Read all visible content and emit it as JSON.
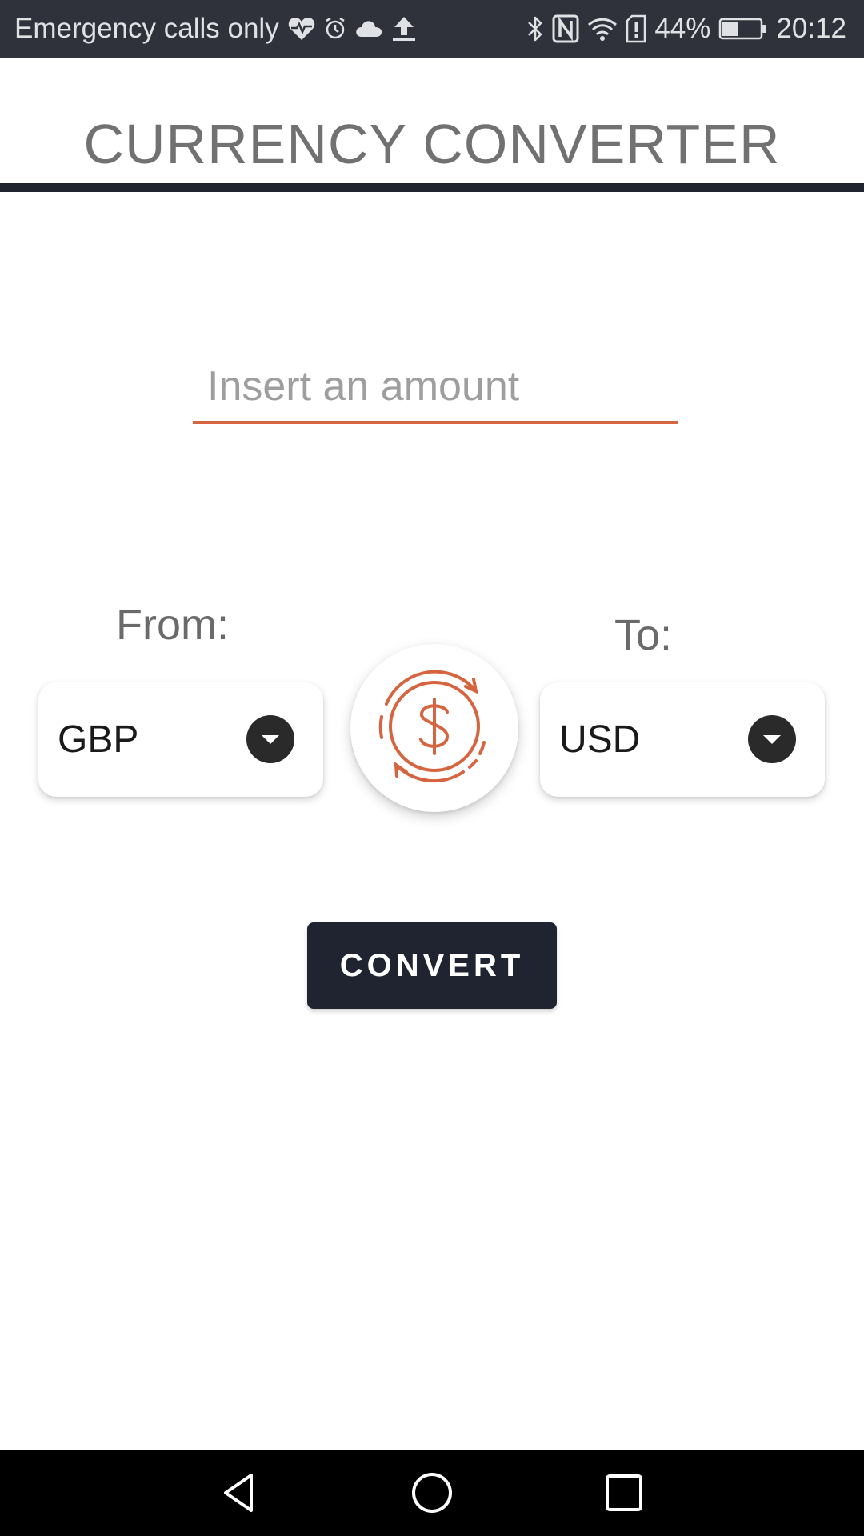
{
  "status_bar": {
    "carrier_text": "Emergency calls only",
    "battery_percent": "44%",
    "battery_level": 0.44,
    "time": "20:12",
    "left_icons": [
      "heart-pulse-icon",
      "alarm-icon",
      "cloud-icon",
      "upload-icon"
    ],
    "right_icons": [
      "bluetooth-icon",
      "nfc-icon",
      "wifi-icon",
      "sim-alert-icon",
      "battery-icon"
    ]
  },
  "header": {
    "title": "CURRENCY CONVERTER"
  },
  "amount": {
    "value": "",
    "placeholder": "Insert an amount"
  },
  "from": {
    "label": "From:",
    "selected": "GBP"
  },
  "to": {
    "label": "To:",
    "selected": "USD"
  },
  "swap": {
    "icon": "currency-exchange-icon"
  },
  "actions": {
    "convert_label": "CONVERT"
  },
  "nav_bar": {
    "icons": [
      "back-icon",
      "home-icon",
      "recents-icon"
    ]
  },
  "colors": {
    "accent": "#d5643f",
    "dark": "#1f2430",
    "status_bar": "#2f323a",
    "title_text": "#717171"
  }
}
